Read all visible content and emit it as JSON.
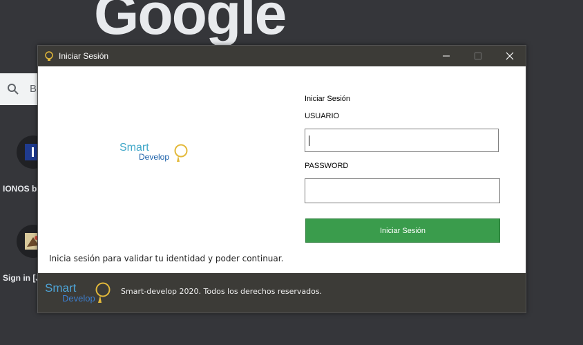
{
  "background": {
    "logo_text": "Google",
    "search_placeholder": "B",
    "shortcuts": [
      {
        "label": "IONOS by",
        "icon": "ionos-icon"
      },
      {
        "label": "Sign in [J",
        "icon": "site-favicon-icon"
      }
    ]
  },
  "dialog": {
    "title": "Iniciar Sesión",
    "window_controls": [
      "minimize-icon",
      "maximize-icon",
      "close-icon"
    ],
    "logo": {
      "line1": "Smart",
      "line2": "Develop"
    },
    "form": {
      "heading": "Iniciar Sesión",
      "username_label": "USUARIO",
      "username_value": "",
      "password_label": "PASSWORD",
      "password_value": "",
      "submit_label": "Iniciar Sesión"
    },
    "hint": "Inicia sesión para validar tu identidad y poder continuar.",
    "footer": {
      "logo_line1": "Smart",
      "logo_line2": "Develop",
      "copyright": "Smart-develop 2020. Todos los derechos reservados."
    }
  },
  "colors": {
    "titlebar": "#3c3b37",
    "submit": "#3a9c4c",
    "logo_light": "#41a8c9",
    "logo_dark": "#1a5fa8",
    "bulb": "#e3b93a"
  }
}
